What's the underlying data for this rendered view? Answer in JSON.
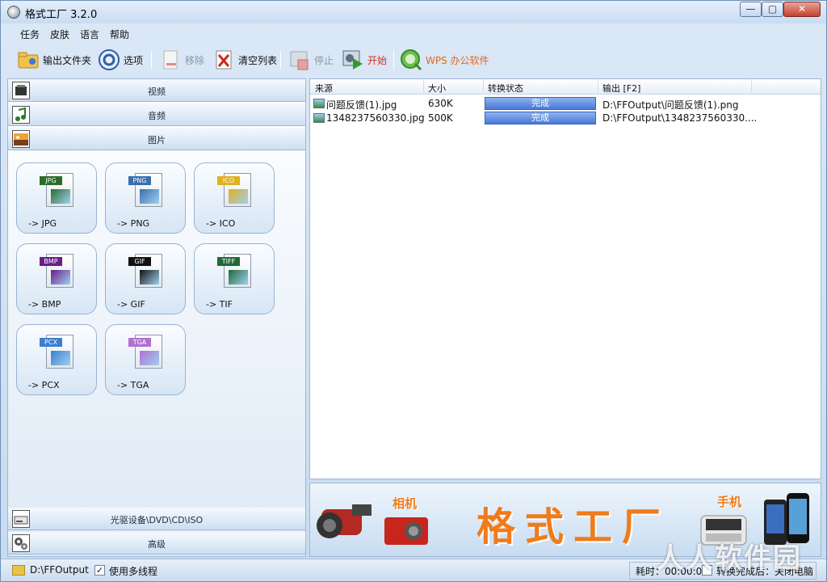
{
  "window": {
    "title": "格式工厂 3.2.0"
  },
  "menu": [
    "任务",
    "皮肤",
    "语言",
    "帮助"
  ],
  "toolbar": {
    "output_folder": "输出文件夹",
    "options": "选项",
    "remove": "移除",
    "clear_list": "清空列表",
    "stop": "停止",
    "start": "开始",
    "wps": "WPS 办公软件"
  },
  "categories": {
    "video": "视频",
    "audio": "音频",
    "image": "图片",
    "rom": "光驱设备\\DVD\\CD\\ISO",
    "advanced": "高级"
  },
  "formats": [
    {
      "tag": "JPG",
      "label": "-> JPG",
      "color": "#2d6b2d"
    },
    {
      "tag": "PNG",
      "label": "-> PNG",
      "color": "#3a6fb0"
    },
    {
      "tag": "ICO",
      "label": "-> ICO",
      "color": "#e0b020"
    },
    {
      "tag": "BMP",
      "label": "-> BMP",
      "color": "#6a1d8a"
    },
    {
      "tag": "GIF",
      "label": "-> GIF",
      "color": "#111111"
    },
    {
      "tag": "TIFF",
      "label": "-> TIF",
      "color": "#1f6a3a"
    },
    {
      "tag": "PCX",
      "label": "-> PCX",
      "color": "#3a7fd0"
    },
    {
      "tag": "TGA",
      "label": "-> TGA",
      "color": "#b070d0"
    }
  ],
  "table": {
    "headers": {
      "source": "来源",
      "size": "大小",
      "status": "转换状态",
      "output": "输出 [F2]"
    },
    "rows": [
      {
        "source": "问题反馈(1).jpg",
        "size": "630K",
        "status": "完成",
        "output": "D:\\FFOutput\\问题反馈(1).png"
      },
      {
        "source": "1348237560330.jpg",
        "size": "500K",
        "status": "完成",
        "output": "D:\\FFOutput\\1348237560330...."
      }
    ]
  },
  "banner": {
    "camera": "相机",
    "title": "格式工厂",
    "phone": "手机"
  },
  "statusbar": {
    "path": "D:\\FFOutput",
    "multithread": "使用多线程",
    "elapsed": "耗时：00:00:01",
    "after_done": "转换完成后：关闭电脑"
  },
  "watermark": "人人软件园"
}
